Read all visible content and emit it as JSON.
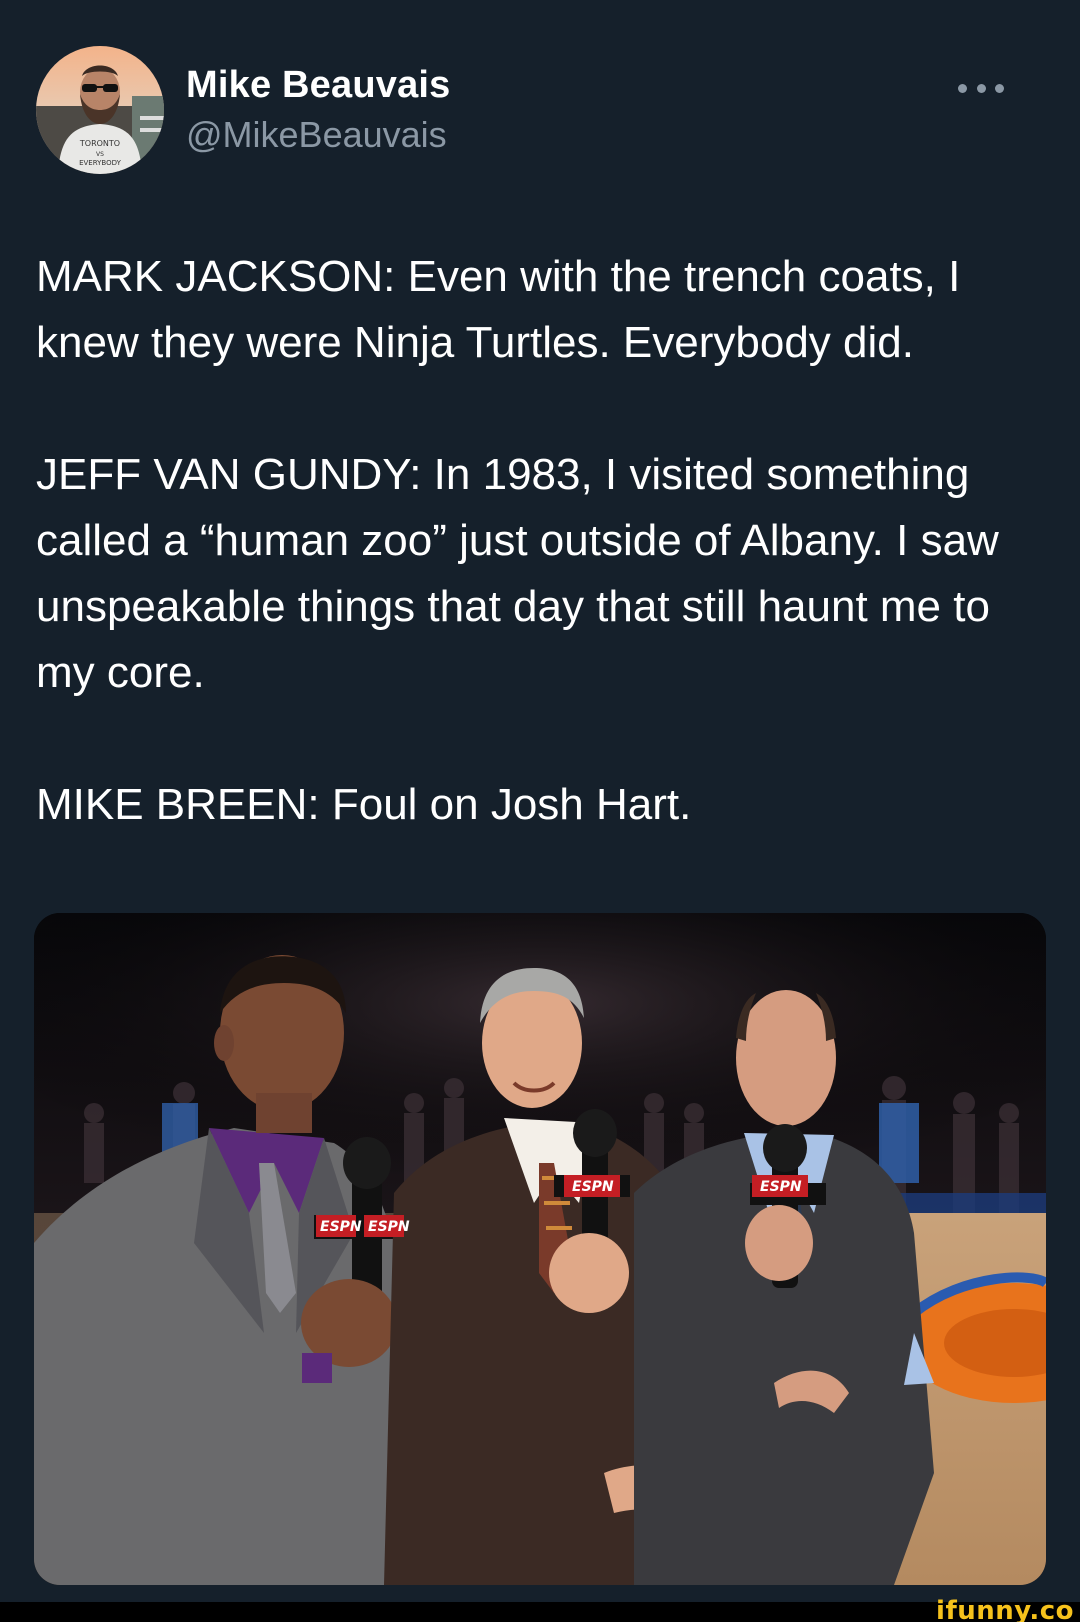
{
  "author": {
    "display_name": "Mike Beauvais",
    "handle": "@MikeBeauvais",
    "avatar_icon": "profile-photo"
  },
  "more_icon": "more-options-icon",
  "tweet": {
    "paragraphs": [
      "MARK JACKSON: Even with the trench coats, I knew they were Ninja Turtles. Everybody did.",
      "JEFF VAN GUNDY: In 1983, I visited something called a “human zoo” just outside of Albany. I saw unspeakable things that day that still haunt me to my core.",
      "MIKE BREEN: Foul on Josh Hart."
    ]
  },
  "media": {
    "mic_flag_text": "ESPN"
  },
  "watermark": "ifunny.co",
  "colors": {
    "background": "#15202b",
    "text": "#ffffff",
    "secondary_text": "#8b98a5",
    "watermark": "#f6c21c"
  }
}
